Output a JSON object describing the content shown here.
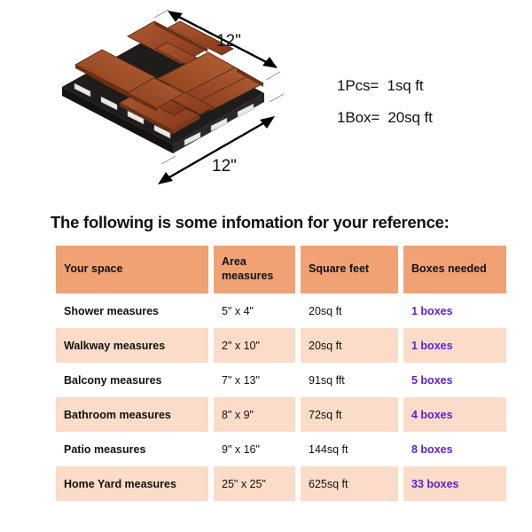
{
  "illustration": {
    "alt_name": "interlocking-wood-deck-tile",
    "dimension_top_label": "12\"",
    "dimension_bottom_label": "12\"",
    "wood_color": "#9b4a26",
    "wood_color_light": "#b4613a",
    "wood_color_dark": "#6e3317",
    "base_color": "#1c1c1c",
    "clip_color": "#e8e8e8",
    "dimension_line_color": "#000000"
  },
  "spec": {
    "lines": [
      "1Pcs=  1sq ft",
      "1Box=  20sq ft"
    ]
  },
  "heading": {
    "text": "The following is some infomation for your reference:"
  },
  "table": {
    "accent_header_color": "#f0a274",
    "accent_row_color": "#fadcc8",
    "boxes_text_color": "#5b21d6",
    "columns": [
      "Your space",
      "Area measures",
      "Square feet",
      "Boxes needed"
    ],
    "rows": [
      {
        "space": "Shower measures",
        "area": "5\" x 4\"",
        "sqft": "20sq ft",
        "boxes": "1 boxes",
        "shaded": false
      },
      {
        "space": "Walkway measures",
        "area": "2\" x 10\"",
        "sqft": "20sq ft",
        "boxes": "1 boxes",
        "shaded": true
      },
      {
        "space": "Balcony measures",
        "area": "7\" x 13\"",
        "sqft": "91sq fft",
        "boxes": "5 boxes",
        "shaded": false
      },
      {
        "space": "Bathroom measures",
        "area": "8\" x 9\"",
        "sqft": "72sq ft",
        "boxes": "4 boxes",
        "shaded": true
      },
      {
        "space": "Patio measures",
        "area": "9\" x 16\"",
        "sqft": "144sq ft",
        "boxes": "8 boxes",
        "shaded": false
      },
      {
        "space": "Home Yard measures",
        "area": "25\" x 25\"",
        "sqft": "625sq ft",
        "boxes": "33 boxes",
        "shaded": true
      }
    ]
  }
}
